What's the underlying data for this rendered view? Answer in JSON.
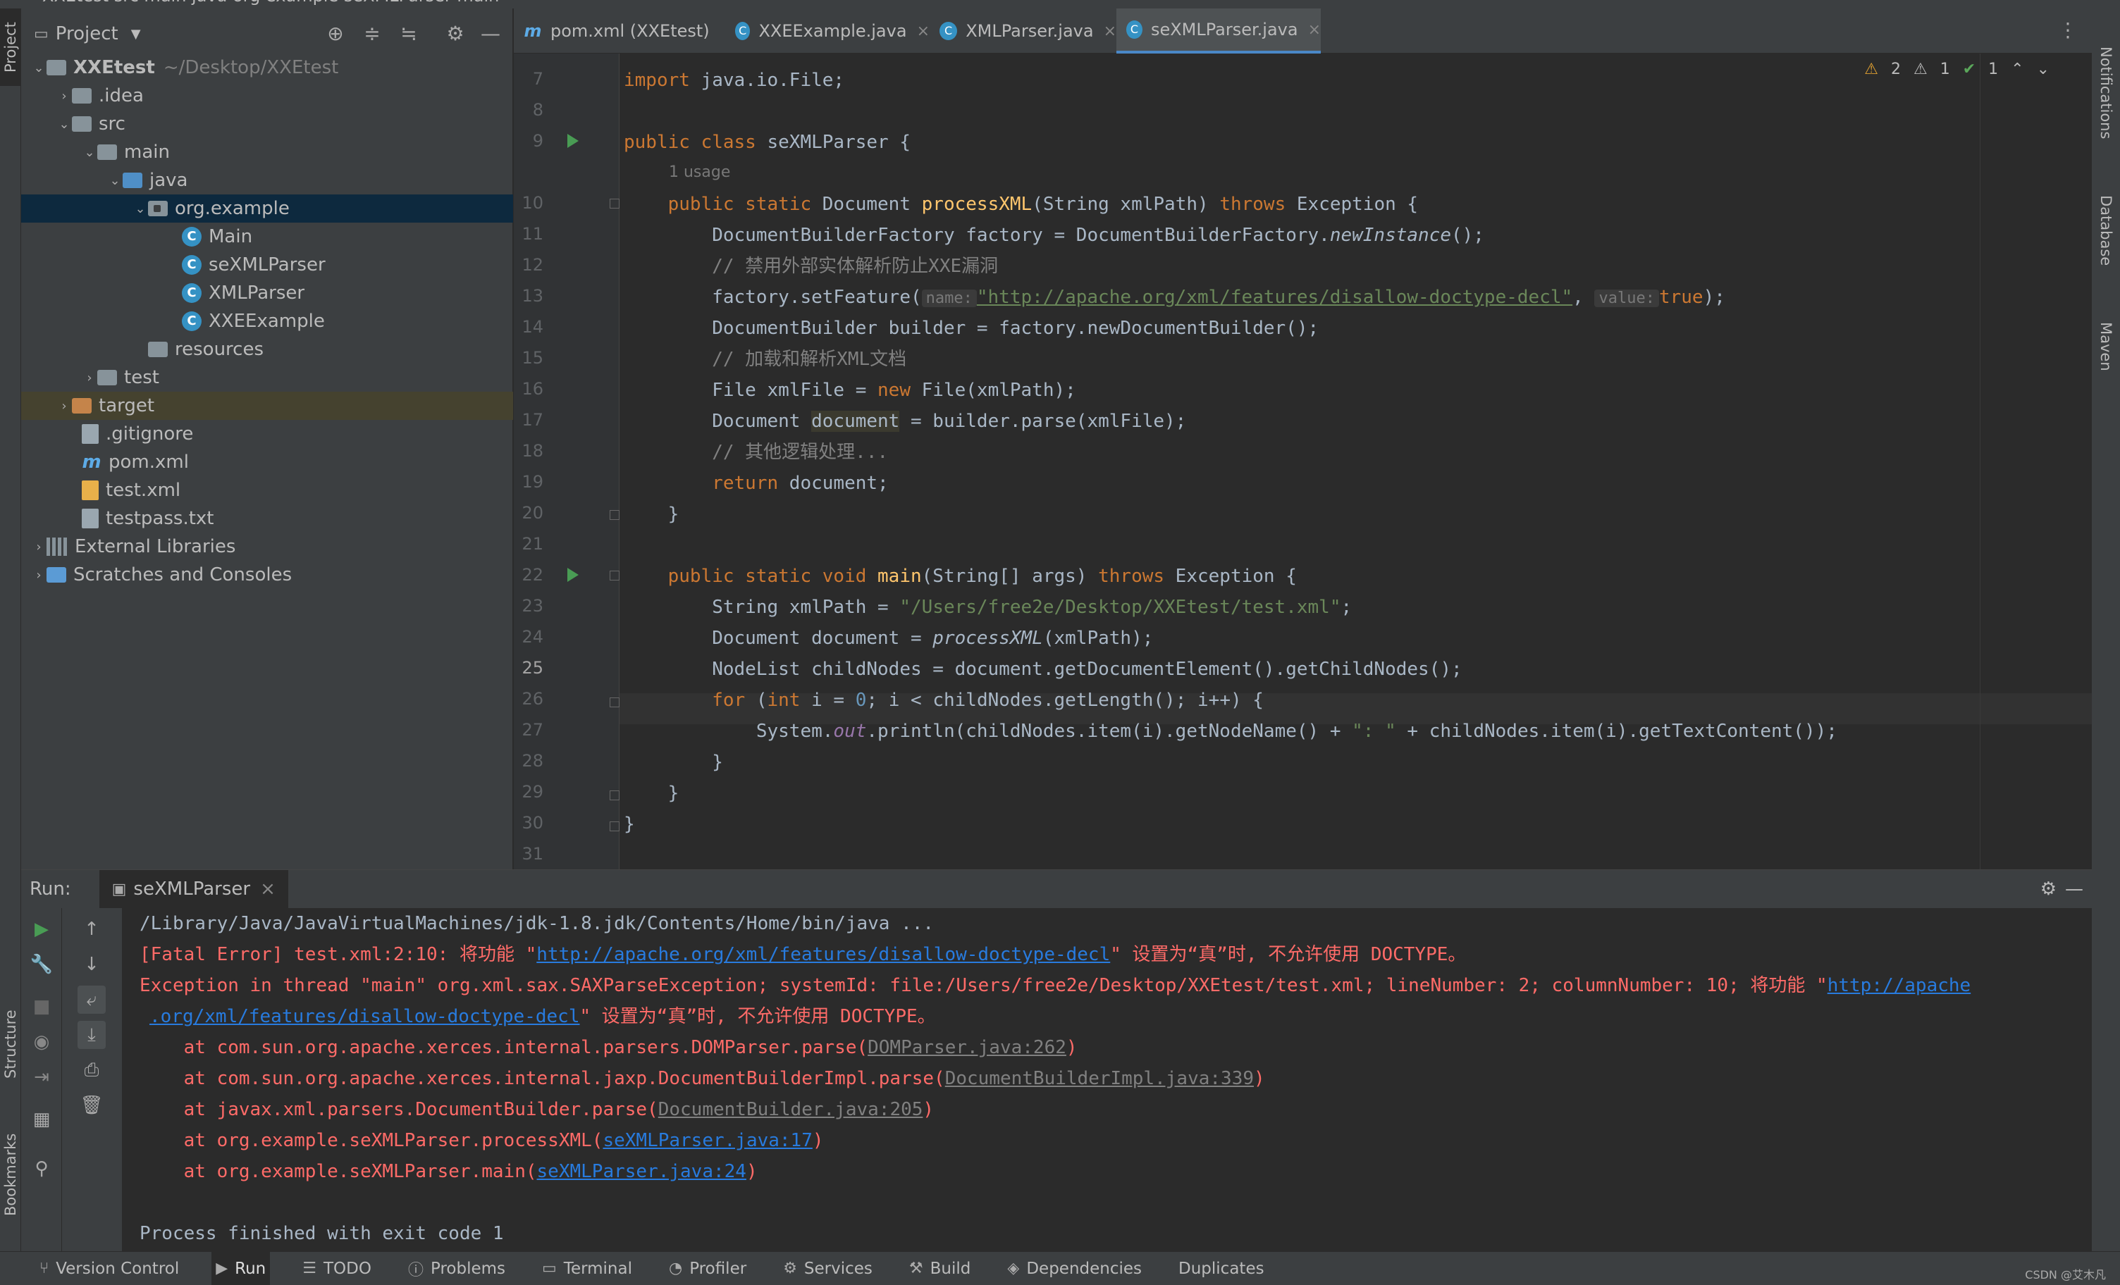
{
  "titlebar": {
    "text": "XXEtest  src  main  java  org  example  seXMLParser  main"
  },
  "left_strip": {
    "project": "Project",
    "structure": "Structure",
    "bookmarks": "Bookmarks"
  },
  "right_strip": {
    "notifications": "Notifications",
    "database": "Database",
    "maven": "Maven"
  },
  "project_panel": {
    "title": "Project",
    "tree": [
      {
        "label": "XXEtest",
        "dim": "~/Desktop/XXEtest"
      },
      {
        "label": ".idea"
      },
      {
        "label": "src"
      },
      {
        "label": "main"
      },
      {
        "label": "java"
      },
      {
        "label": "org.example"
      },
      {
        "label": "Main"
      },
      {
        "label": "seXMLParser"
      },
      {
        "label": "XMLParser"
      },
      {
        "label": "XXEExample"
      },
      {
        "label": "resources"
      },
      {
        "label": "test"
      },
      {
        "label": "target"
      },
      {
        "label": ".gitignore"
      },
      {
        "label": "pom.xml"
      },
      {
        "label": "test.xml"
      },
      {
        "label": "testpass.txt"
      },
      {
        "label": "External Libraries"
      },
      {
        "label": "Scratches and Consoles"
      }
    ]
  },
  "tabs": [
    {
      "label": "pom.xml (XXEtest)"
    },
    {
      "label": "XXEExample.java"
    },
    {
      "label": "XMLParser.java"
    },
    {
      "label": "seXMLParser.java"
    }
  ],
  "inspections": {
    "warn1": "2",
    "warn2": "1",
    "ok": "1"
  },
  "editor": {
    "line_numbers": [
      "7",
      "8",
      "9",
      "10",
      "11",
      "12",
      "13",
      "14",
      "15",
      "16",
      "17",
      "18",
      "19",
      "20",
      "21",
      "22",
      "23",
      "24",
      "25",
      "26",
      "27",
      "28",
      "29",
      "30",
      "31"
    ],
    "usage_hint": "1 usage",
    "lines": {
      "l7a": "import",
      "l7b": " java.io.File;",
      "l9a": "public class",
      "l9b": " seXMLParser {",
      "l10a": "    public static ",
      "l10b": "Document ",
      "l10c": "processXML",
      "l10d": "(String xmlPath) ",
      "l10e": "throws",
      "l10f": " Exception {",
      "l11a": "        DocumentBuilderFactory factory = DocumentBuilderFactory.",
      "l11b": "newInstance",
      "l11c": "();",
      "l12": "        // 禁用外部实体解析防止XXE漏洞",
      "l13a": "        factory.setFeature(",
      "l13h1": "name:",
      "l13b": "\"http://apache.org/xml/features/disallow-doctype-decl\"",
      "l13c": ", ",
      "l13h2": "value:",
      "l13d": "true",
      "l13e": ");",
      "l14": "        DocumentBuilder builder = factory.newDocumentBuilder();",
      "l15": "        // 加载和解析XML文档",
      "l16a": "        File xmlFile = ",
      "l16b": "new",
      "l16c": " File(xmlPath);",
      "l17a": "        Document ",
      "l17b": "document",
      "l17c": " = builder.parse(xmlFile);",
      "l18": "        // 其他逻辑处理...",
      "l19a": "        return",
      "l19b": " document;",
      "l20": "    }",
      "l22a": "    public static void ",
      "l22b": "main",
      "l22c": "(String[] args) ",
      "l22d": "throws",
      "l22e": " Exception {",
      "l23a": "        String xmlPath = ",
      "l23b": "\"/Users/free2e/Desktop/XXEtest/test.xml\"",
      "l23c": ";",
      "l24a": "        Document document = ",
      "l24b": "processXML",
      "l24c": "(xmlPath);",
      "l25": "        NodeList childNodes = document.getDocumentElement().getChildNodes();",
      "l26a": "        for",
      "l26b": " (",
      "l26c": "int",
      "l26d": " i = ",
      "l26e": "0",
      "l26f": "; i < childNodes.getLength(); i++) {",
      "l27a": "            System.",
      "l27b": "out",
      "l27c": ".println(childNodes.item(i).getNodeName() + ",
      "l27d": "\": \"",
      "l27e": " + childNodes.item(i).getTextContent());",
      "l28": "        }",
      "l29": "    }",
      "l30": "}"
    }
  },
  "run_panel": {
    "label": "Run:",
    "tab": "seXMLParser",
    "console": {
      "c1": "/Library/Java/JavaVirtualMachines/jdk-1.8.jdk/Contents/Home/bin/java ...",
      "c2a": "[Fatal Error] test.xml:2:10: 将功能 \"",
      "c2b": "http://apache.org/xml/features/disallow-doctype-decl",
      "c2c": "\" 设置为“真”时, 不允许使用 DOCTYPE。",
      "c3a": "Exception in thread \"main\" org.xml.sax.SAXParseException; systemId: file:/Users/free2e/Desktop/XXEtest/test.xml; lineNumber: 2; columnNumber: 10; 将功能 \"",
      "c3b": "http://apache",
      "c4a": ".org/xml/features/disallow-doctype-decl",
      "c4b": "\" 设置为“真”时, 不允许使用 DOCTYPE。",
      "c5a": "    at com.sun.org.apache.xerces.internal.parsers.DOMParser.parse(",
      "c5b": "DOMParser.java:262",
      "c5c": ")",
      "c6a": "    at com.sun.org.apache.xerces.internal.jaxp.DocumentBuilderImpl.parse(",
      "c6b": "DocumentBuilderImpl.java:339",
      "c6c": ")",
      "c7a": "    at javax.xml.parsers.DocumentBuilder.parse(",
      "c7b": "DocumentBuilder.java:205",
      "c7c": ")",
      "c8a": "    at org.example.seXMLParser.processXML(",
      "c8b": "seXMLParser.java:17",
      "c8c": ")",
      "c9a": "    at org.example.seXMLParser.main(",
      "c9b": "seXMLParser.java:24",
      "c9c": ")",
      "c10": "Process finished with exit code 1"
    }
  },
  "statusbar": {
    "items": [
      "Version Control",
      "Run",
      "TODO",
      "Problems",
      "Terminal",
      "Profiler",
      "Services",
      "Build",
      "Dependencies",
      "Duplicates"
    ]
  },
  "watermark": "CSDN @艾木凡",
  "colors": {
    "keyword": "#cc7832",
    "string": "#6a8759",
    "function": "#ffc66d",
    "error": "#ff6b68",
    "link": "#287bde"
  }
}
